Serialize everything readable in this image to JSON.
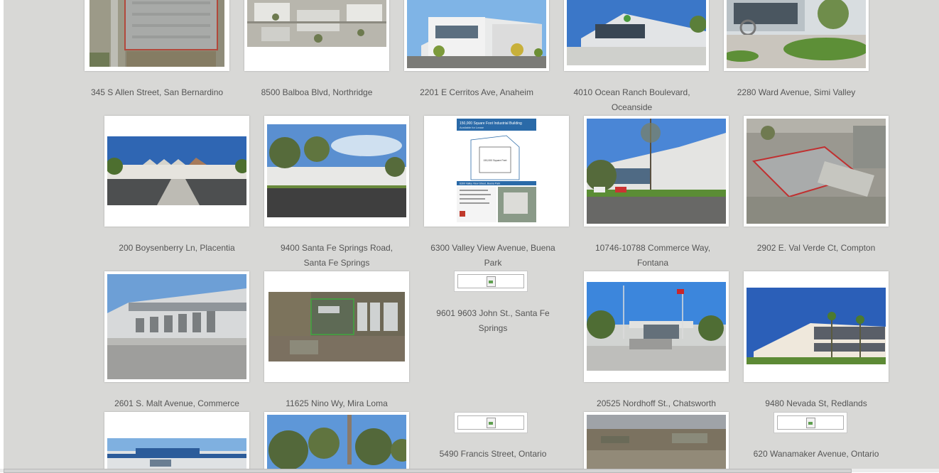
{
  "listings": [
    {
      "caption": "345 S Allen Street, San Bernardino"
    },
    {
      "caption": "8500 Balboa Blvd, Northridge"
    },
    {
      "caption": "2201 E Cerritos Ave, Anaheim"
    },
    {
      "caption": "4010 Ocean Ranch Boulevard, Oceanside"
    },
    {
      "caption": "2280 Ward Avenue, Simi Valley"
    },
    {
      "caption": "200 Boysenberry Ln, Placentia"
    },
    {
      "caption": "9400 Santa Fe Springs Road, Santa Fe Springs"
    },
    {
      "caption": "6300 Valley View Avenue, Buena Park"
    },
    {
      "caption": "10746-10788 Commerce Way, Fontana"
    },
    {
      "caption": "2902 E. Val Verde Ct, Compton"
    },
    {
      "caption": "2601 S. Malt Avenue, Commerce"
    },
    {
      "caption": "11625 Nino Wy, Mira Loma"
    },
    {
      "caption": "9601 9603 John St., Santa Fe Springs"
    },
    {
      "caption": "20525 Nordhoff St., Chatsworth"
    },
    {
      "caption": "9480 Nevada St, Redlands"
    },
    {
      "caption": "5490 Francis Street, Ontario"
    },
    {
      "caption": "620 Wanamaker Avenue, Ontario"
    }
  ],
  "brochure": {
    "title": "150,000 Square Foot Industrial Building",
    "subtitle": "Available for Lease",
    "plan_label": "150,000 Square Feet",
    "address_line": "6300 Valley View Street, Buena Park"
  },
  "colors": {
    "page_background": "#d8d8d6",
    "card_background": "#ffffff",
    "caption_text": "#555555"
  }
}
